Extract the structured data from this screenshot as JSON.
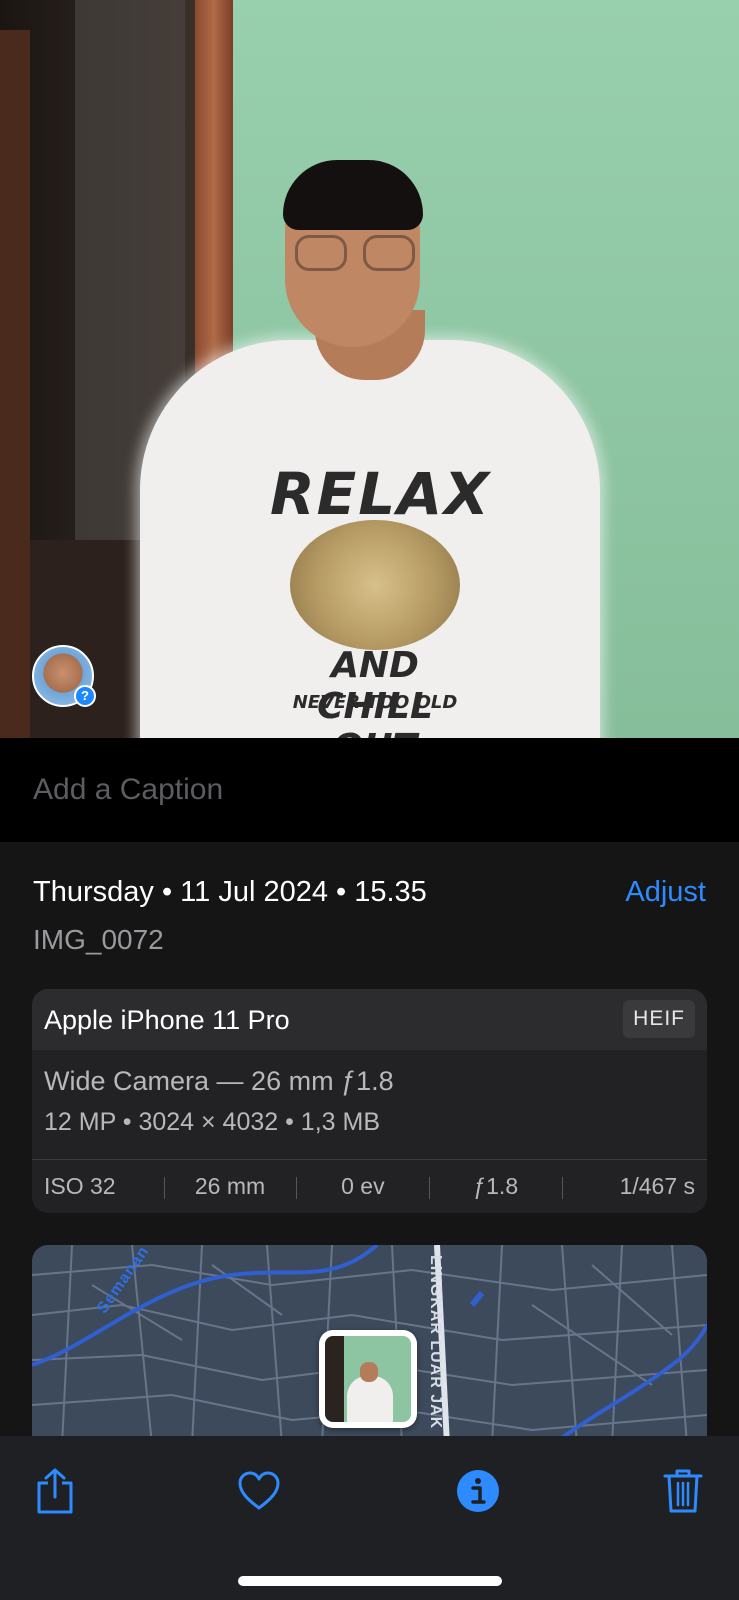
{
  "caption": {
    "placeholder": "Add a Caption"
  },
  "info": {
    "date_line": "Thursday • 11 Jul 2024 • 15.35",
    "adjust_label": "Adjust",
    "filename": "IMG_0072"
  },
  "camera": {
    "device": "Apple iPhone 11 Pro",
    "format": "HEIF",
    "lens": "Wide Camera — 26 mm ƒ1.8",
    "specs": "12 MP  •  3024 × 4032  •  1,3 MB",
    "exif": [
      "ISO 32",
      "26 mm",
      "0 ev",
      "ƒ1.8",
      "1/467 s"
    ]
  },
  "map": {
    "labels": [
      "Semanan",
      "LINGKAR LUAR JAK"
    ]
  },
  "photo": {
    "shirt_text": [
      "RELAX",
      "AND CHILL OUT",
      "NEVER TOO OLD"
    ],
    "badge_symbol": "?"
  },
  "toolbar": {
    "icons": [
      "share-icon",
      "heart-icon",
      "info-icon",
      "trash-icon"
    ]
  },
  "colors": {
    "accent": "#2e8bff",
    "background": "#151515",
    "card": "#222224"
  }
}
